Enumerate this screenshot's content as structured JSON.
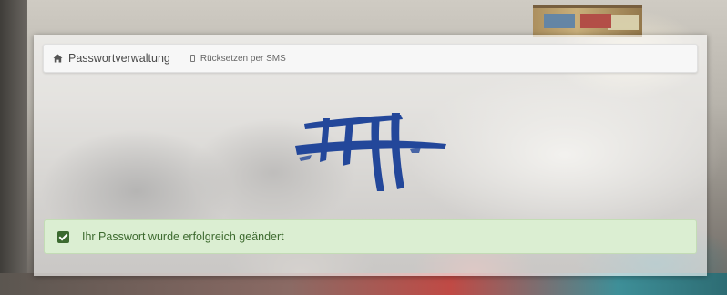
{
  "navbar": {
    "home": {
      "icon": "home-icon",
      "label": "Passwortverwaltung"
    },
    "sms_reset": {
      "icon": "mobile-phone-icon",
      "label": "Rücksetzen per SMS"
    }
  },
  "logo": {
    "icon": "school-logo-brush-strokes",
    "color": "#23479a"
  },
  "alert": {
    "type": "success",
    "icon": "check-square-icon",
    "message": "Ihr Passwort wurde erfolgreich geändert",
    "background": "#dbeed2",
    "text_color": "#3d6a2f"
  },
  "colors": {
    "card_overlay": "rgba(255,255,255,0.62)",
    "navbar_bg": "#f7f7f7"
  }
}
